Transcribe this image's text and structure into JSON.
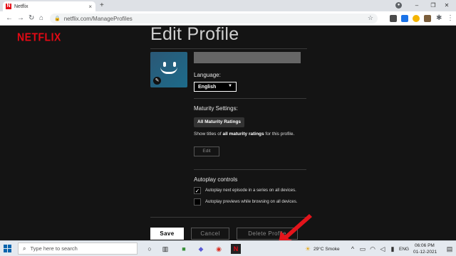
{
  "browser": {
    "tab_title": "Netflix",
    "tab_close": "×",
    "new_tab": "+",
    "url": "netflix.com/ManageProfiles",
    "win_min": "–",
    "win_max": "❐",
    "win_close": "✕"
  },
  "page": {
    "logo": "NETFLIX",
    "title": "Edit Profile",
    "profile_name_value": "",
    "language_label": "Language:",
    "language_value": "English",
    "maturity_label": "Maturity Settings:",
    "maturity_badge": "All Maturity Ratings",
    "maturity_info_prefix": "Show titles of ",
    "maturity_info_bold": "all maturity ratings",
    "maturity_info_suffix": " for this profile.",
    "edit_button": "Edit",
    "autoplay_label": "Autoplay controls",
    "autoplay_next": "Autoplay next episode in a series on all devices.",
    "autoplay_next_checked": true,
    "autoplay_previews": "Autoplay previews while browsing on all devices.",
    "autoplay_previews_checked": false,
    "save_button": "Save",
    "cancel_button": "Cancel",
    "delete_button": "Delete Profile"
  },
  "taskbar": {
    "search_placeholder": "Type here to search",
    "weather": "29°C  Smoke",
    "language": "ENG",
    "time": "06:06 PM",
    "date": "01-12-2021"
  },
  "colors": {
    "netflix_red": "#e50914",
    "page_bg": "#141414",
    "arrow_red": "#e3141b"
  }
}
